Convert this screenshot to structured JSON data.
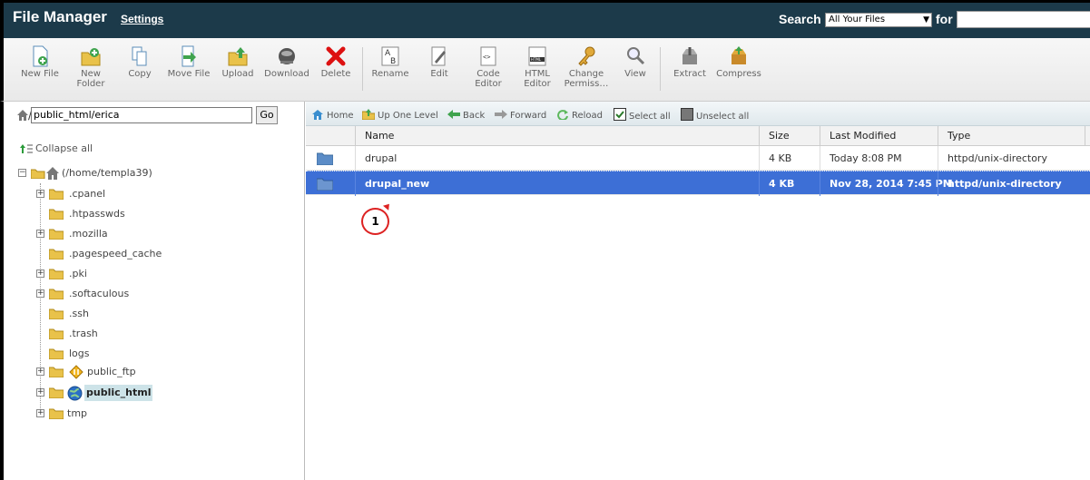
{
  "header": {
    "title": "File Manager",
    "settings": "Settings",
    "search_label": "Search",
    "search_scope": "All Your Files",
    "for_label": "for",
    "search_value": ""
  },
  "toolbar": {
    "items": [
      {
        "label": "New File",
        "icon": "new-file-icon"
      },
      {
        "label": "New Folder",
        "icon": "new-folder-icon"
      },
      {
        "label": "Copy",
        "icon": "copy-icon"
      },
      {
        "label": "Move File",
        "icon": "move-file-icon"
      },
      {
        "label": "Upload",
        "icon": "upload-icon"
      },
      {
        "label": "Download",
        "icon": "download-icon"
      },
      {
        "label": "Delete",
        "icon": "delete-icon"
      },
      {
        "label": "Rename",
        "icon": "rename-icon"
      },
      {
        "label": "Edit",
        "icon": "edit-icon"
      },
      {
        "label": "Code Editor",
        "icon": "code-editor-icon"
      },
      {
        "label": "HTML Editor",
        "icon": "html-editor-icon"
      },
      {
        "label": "Change Permiss…",
        "icon": "permissions-icon"
      },
      {
        "label": "View",
        "icon": "view-icon"
      },
      {
        "label": "Extract",
        "icon": "extract-icon"
      },
      {
        "label": "Compress",
        "icon": "compress-icon"
      }
    ]
  },
  "left": {
    "path_value": "public_html/erica",
    "go_label": "Go",
    "collapse_all": "Collapse all",
    "root_label": "(/home/templa39)",
    "tree": [
      {
        "label": ".cpanel",
        "expandable": true
      },
      {
        "label": ".htpasswds",
        "expandable": false
      },
      {
        "label": ".mozilla",
        "expandable": true
      },
      {
        "label": ".pagespeed_cache",
        "expandable": false
      },
      {
        "label": ".pki",
        "expandable": true
      },
      {
        "label": ".softaculous",
        "expandable": true
      },
      {
        "label": ".ssh",
        "expandable": false
      },
      {
        "label": ".trash",
        "expandable": false
      },
      {
        "label": "logs",
        "expandable": false
      },
      {
        "label": "public_ftp",
        "expandable": true
      },
      {
        "label": "public_html",
        "expandable": true
      },
      {
        "label": "tmp",
        "expandable": true
      }
    ]
  },
  "nav": {
    "home": "Home",
    "up_one_level": "Up One Level",
    "back": "Back",
    "forward": "Forward",
    "reload": "Reload",
    "select_all": "Select all",
    "unselect_all": "Unselect all"
  },
  "grid": {
    "headers": {
      "name": "Name",
      "size": "Size",
      "modified": "Last Modified",
      "type": "Type"
    },
    "rows": [
      {
        "name": "drupal",
        "size": "4 KB",
        "modified": "Today 8:08 PM",
        "type": "httpd/unix-directory"
      },
      {
        "name": "drupal_new",
        "size": "4 KB",
        "modified": "Nov 28, 2014 7:45 PM",
        "type": "httpd/unix-directory"
      }
    ]
  },
  "callout": "1",
  "colors": {
    "header_bg": "#1c3a4a",
    "selection": "#3d6fd6"
  }
}
